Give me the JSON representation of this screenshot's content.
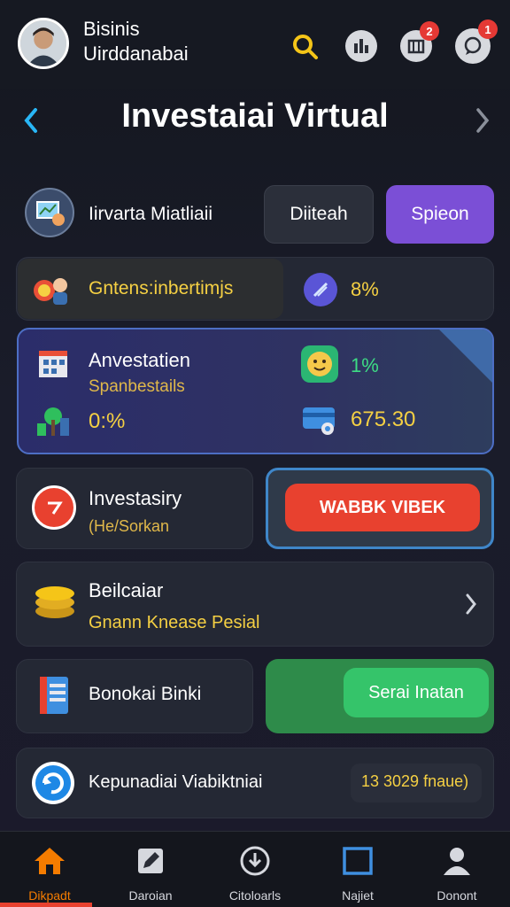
{
  "header": {
    "user_line1": "Bisinis",
    "user_line2": "Uirddanabai",
    "badges": {
      "notifications": "2",
      "messages": "1"
    },
    "icons": [
      "avatar",
      "search-icon",
      "stats-icon",
      "archive-icon",
      "chat-icon"
    ]
  },
  "title_bar": {
    "title": "Investaiai Virtual"
  },
  "row1": {
    "label": "Iirvarta Miatliaii",
    "btn1": "Diiteah",
    "btn2": "Spieon"
  },
  "row2": {
    "label": "Gntens:inbertimjs",
    "value": "8%"
  },
  "invest_card": {
    "title": "Anvestatien",
    "subtitle": "Spanbestails",
    "top_right_value": "1%",
    "bottom_left_value": "0:%",
    "bottom_right_value": "675.30"
  },
  "row4": {
    "title": "Investasiry",
    "subtitle": "(He/Sorkan",
    "button": "WABBK VIBEK"
  },
  "row5": {
    "title": "Beilcaiar",
    "subtitle": "Gnann Knease Pesial"
  },
  "row6": {
    "label": "Bonokai Binki",
    "button": "Serai Inatan"
  },
  "row7": {
    "label": "Kepunadiai Viabiktniai",
    "value": "13 3029 fnaue)"
  },
  "bottom_nav": [
    {
      "label": "Dikpadt",
      "icon": "home-icon"
    },
    {
      "label": "Daroian",
      "icon": "edit-icon"
    },
    {
      "label": "Citoloarls",
      "icon": "download-icon"
    },
    {
      "label": "Najiet",
      "icon": "frame-icon"
    },
    {
      "label": "Donont",
      "icon": "user-icon"
    }
  ],
  "colors": {
    "accent_yellow": "#f5d043",
    "purple": "#7b4fd6",
    "red": "#e8412f",
    "green": "#2fbf5d",
    "blue_border": "#3f86c9"
  }
}
